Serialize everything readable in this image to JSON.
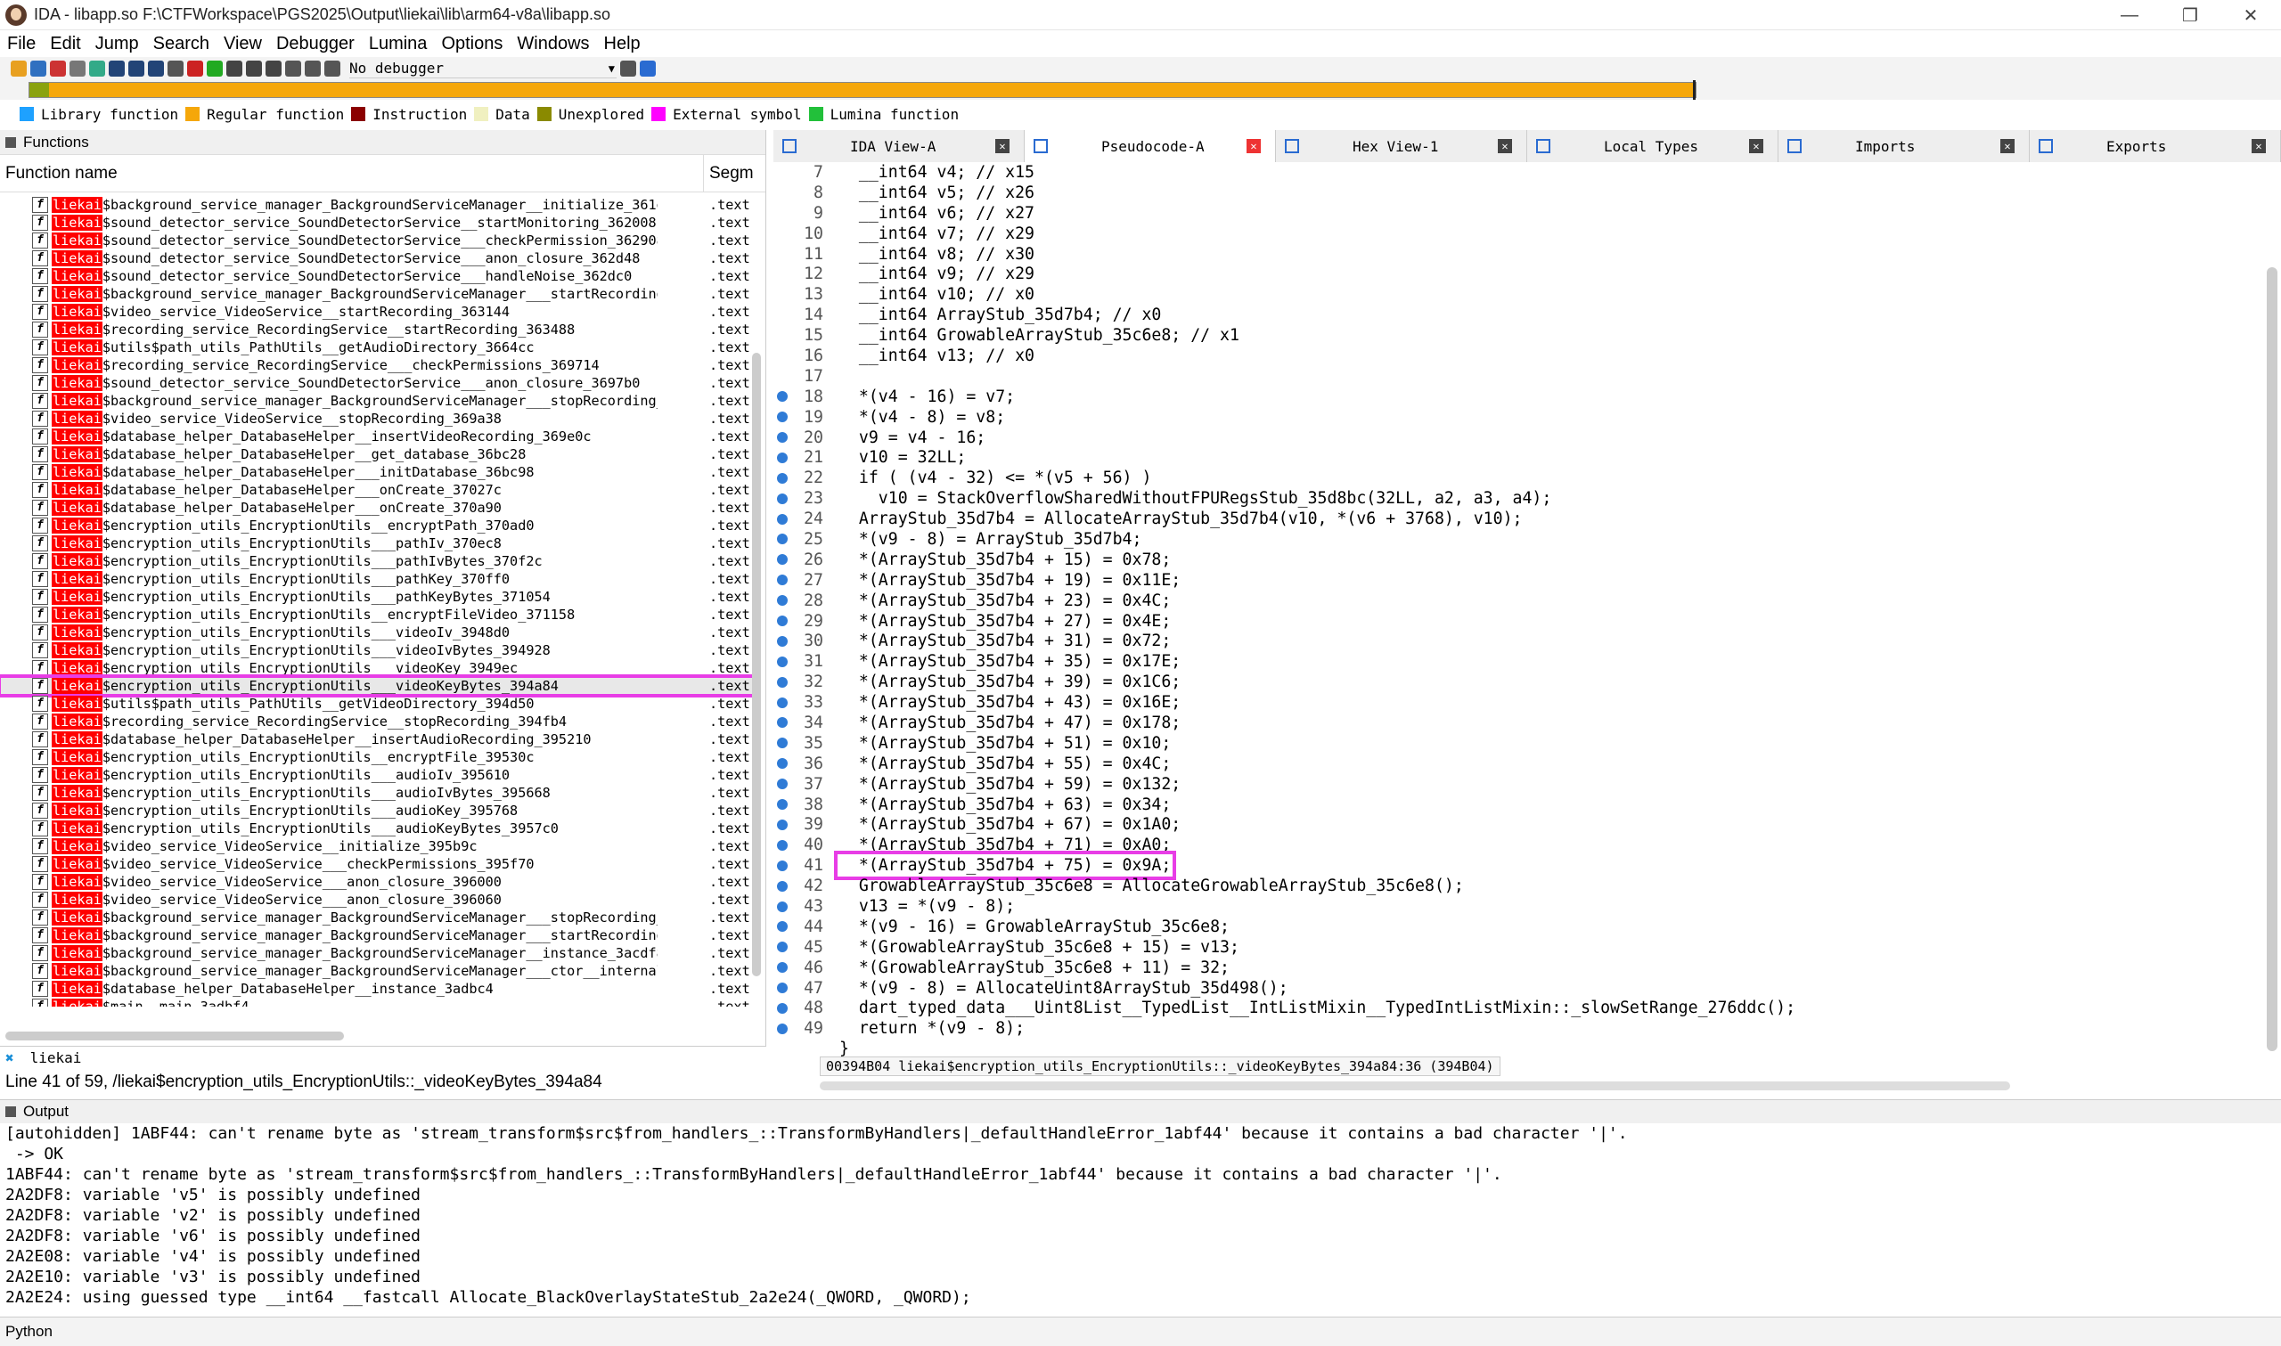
{
  "window": {
    "title": "IDA - libapp.so F:\\CTFWorkspace\\PGS2025\\Output\\liekai\\lib\\arm64-v8a\\libapp.so"
  },
  "menu": [
    "File",
    "Edit",
    "Jump",
    "Search",
    "View",
    "Debugger",
    "Lumina",
    "Options",
    "Windows",
    "Help"
  ],
  "toolbar": {
    "debugger": "No debugger"
  },
  "legend": [
    {
      "label": "Library function",
      "color": "#1ea1ff"
    },
    {
      "label": "Regular function",
      "color": "#f5a70a"
    },
    {
      "label": "Instruction",
      "color": "#8b0000"
    },
    {
      "label": "Data",
      "color": "#f0f0c0"
    },
    {
      "label": "Unexplored",
      "color": "#8a8a00"
    },
    {
      "label": "External symbol",
      "color": "#ff00ff"
    },
    {
      "label": "Lumina function",
      "color": "#22c03a"
    }
  ],
  "functions_panel": {
    "title": "Functions",
    "col_name": "Function name",
    "col_seg": "Segm",
    "prefix": "liekai",
    "rows": [
      {
        "n": "$background_service_manager_BackgroundServiceManager__initialize_361e30",
        "s": ".text"
      },
      {
        "n": "$sound_detector_service_SoundDetectorService__startMonitoring_362008",
        "s": ".text"
      },
      {
        "n": "$sound_detector_service_SoundDetectorService___checkPermission_362908",
        "s": ".text"
      },
      {
        "n": "$sound_detector_service_SoundDetectorService___anon_closure_362d48",
        "s": ".text"
      },
      {
        "n": "$sound_detector_service_SoundDetectorService___handleNoise_362dc0",
        "s": ".text"
      },
      {
        "n": "$background_service_manager_BackgroundServiceManager___startRecording_36…",
        "s": ".text"
      },
      {
        "n": "$video_service_VideoService__startRecording_363144",
        "s": ".text"
      },
      {
        "n": "$recording_service_RecordingService__startRecording_363488",
        "s": ".text"
      },
      {
        "n": "$utils$path_utils_PathUtils__getAudioDirectory_3664cc",
        "s": ".text"
      },
      {
        "n": "$recording_service_RecordingService___checkPermissions_369714",
        "s": ".text"
      },
      {
        "n": "$sound_detector_service_SoundDetectorService___anon_closure_3697b0",
        "s": ".text"
      },
      {
        "n": "$background_service_manager_BackgroundServiceManager___stopRecording_369…",
        "s": ".text"
      },
      {
        "n": "$video_service_VideoService__stopRecording_369a38",
        "s": ".text"
      },
      {
        "n": "$database_helper_DatabaseHelper__insertVideoRecording_369e0c",
        "s": ".text"
      },
      {
        "n": "$database_helper_DatabaseHelper__get_database_36bc28",
        "s": ".text"
      },
      {
        "n": "$database_helper_DatabaseHelper___initDatabase_36bc98",
        "s": ".text"
      },
      {
        "n": "$database_helper_DatabaseHelper___onCreate_37027c",
        "s": ".text"
      },
      {
        "n": "$database_helper_DatabaseHelper___onCreate_370a90",
        "s": ".text"
      },
      {
        "n": "$encryption_utils_EncryptionUtils__encryptPath_370ad0",
        "s": ".text"
      },
      {
        "n": "$encryption_utils_EncryptionUtils___pathIv_370ec8",
        "s": ".text"
      },
      {
        "n": "$encryption_utils_EncryptionUtils___pathIvBytes_370f2c",
        "s": ".text"
      },
      {
        "n": "$encryption_utils_EncryptionUtils___pathKey_370ff0",
        "s": ".text"
      },
      {
        "n": "$encryption_utils_EncryptionUtils___pathKeyBytes_371054",
        "s": ".text"
      },
      {
        "n": "$encryption_utils_EncryptionUtils__encryptFileVideo_371158",
        "s": ".text"
      },
      {
        "n": "$encryption_utils_EncryptionUtils___videoIv_3948d0",
        "s": ".text"
      },
      {
        "n": "$encryption_utils_EncryptionUtils___videoIvBytes_394928",
        "s": ".text"
      },
      {
        "n": "$encryption_utils_EncryptionUtils___videoKey_3949ec",
        "s": ".text"
      },
      {
        "n": "$encryption_utils_EncryptionUtils___videoKeyBytes_394a84",
        "s": ".text",
        "hl": true
      },
      {
        "n": "$utils$path_utils_PathUtils__getVideoDirectory_394d50",
        "s": ".text"
      },
      {
        "n": "$recording_service_RecordingService__stopRecording_394fb4",
        "s": ".text"
      },
      {
        "n": "$database_helper_DatabaseHelper__insertAudioRecording_395210",
        "s": ".text"
      },
      {
        "n": "$encryption_utils_EncryptionUtils__encryptFile_39530c",
        "s": ".text"
      },
      {
        "n": "$encryption_utils_EncryptionUtils___audioIv_395610",
        "s": ".text"
      },
      {
        "n": "$encryption_utils_EncryptionUtils___audioIvBytes_395668",
        "s": ".text"
      },
      {
        "n": "$encryption_utils_EncryptionUtils___audioKey_395768",
        "s": ".text"
      },
      {
        "n": "$encryption_utils_EncryptionUtils___audioKeyBytes_3957c0",
        "s": ".text"
      },
      {
        "n": "$video_service_VideoService__initialize_395b9c",
        "s": ".text"
      },
      {
        "n": "$video_service_VideoService___checkPermissions_395f70",
        "s": ".text"
      },
      {
        "n": "$video_service_VideoService___anon_closure_396000",
        "s": ".text"
      },
      {
        "n": "$video_service_VideoService___anon_closure_396060",
        "s": ".text"
      },
      {
        "n": "$background_service_manager_BackgroundServiceManager___stopRecording_396…",
        "s": ".text"
      },
      {
        "n": "$background_service_manager_BackgroundServiceManager___startRecording_39…",
        "s": ".text"
      },
      {
        "n": "$background_service_manager_BackgroundServiceManager__instance_3acdf8",
        "s": ".text"
      },
      {
        "n": "$background_service_manager_BackgroundServiceManager___ctor__internal_3ac…",
        "s": ".text"
      },
      {
        "n": "$database_helper_DatabaseHelper__instance_3adbc4",
        "s": ".text"
      },
      {
        "n": "$main__main_3adbf4",
        "s": ".text"
      }
    ],
    "filter": "liekai",
    "line_info": "Line 41 of 59, /liekai$encryption_utils_EncryptionUtils::_videoKeyBytes_394a84"
  },
  "tabs": [
    {
      "label": "IDA View-A"
    },
    {
      "label": "Pseudocode-A",
      "active": true
    },
    {
      "label": "Hex View-1"
    },
    {
      "label": "Local Types"
    },
    {
      "label": "Imports"
    },
    {
      "label": "Exports"
    }
  ],
  "code_lines": [
    {
      "n": "7",
      "t": "  __int64 v4; // x15"
    },
    {
      "n": "8",
      "t": "  __int64 v5; // x26"
    },
    {
      "n": "9",
      "t": "  __int64 v6; // x27"
    },
    {
      "n": "10",
      "t": "  __int64 v7; // x29"
    },
    {
      "n": "11",
      "t": "  __int64 v8; // x30"
    },
    {
      "n": "12",
      "t": "  __int64 v9; // x29"
    },
    {
      "n": "13",
      "t": "  __int64 v10; // x0"
    },
    {
      "n": "14",
      "t": "  __int64 ArrayStub_35d7b4; // x0"
    },
    {
      "n": "15",
      "t": "  __int64 GrowableArrayStub_35c6e8; // x1"
    },
    {
      "n": "16",
      "t": "  __int64 v13; // x0"
    },
    {
      "n": "17",
      "t": ""
    },
    {
      "n": "18",
      "t": "  *(v4 - 16) = v7;",
      "d": true
    },
    {
      "n": "19",
      "t": "  *(v4 - 8) = v8;",
      "d": true
    },
    {
      "n": "20",
      "t": "  v9 = v4 - 16;",
      "d": true
    },
    {
      "n": "21",
      "t": "  v10 = 32LL;",
      "d": true
    },
    {
      "n": "22",
      "t": "  if ( (v4 - 32) <= *(v5 + 56) )",
      "d": true
    },
    {
      "n": "23",
      "t": "    v10 = StackOverflowSharedWithoutFPURegsStub_35d8bc(32LL, a2, a3, a4);",
      "d": true
    },
    {
      "n": "24",
      "t": "  ArrayStub_35d7b4 = AllocateArrayStub_35d7b4(v10, *(v6 + 3768), v10);",
      "d": true
    },
    {
      "n": "25",
      "t": "  *(v9 - 8) = ArrayStub_35d7b4;",
      "d": true
    },
    {
      "n": "26",
      "t": "  *(ArrayStub_35d7b4 + 15) = 0x78;",
      "d": true
    },
    {
      "n": "27",
      "t": "  *(ArrayStub_35d7b4 + 19) = 0x11E;",
      "d": true
    },
    {
      "n": "28",
      "t": "  *(ArrayStub_35d7b4 + 23) = 0x4C;",
      "d": true
    },
    {
      "n": "29",
      "t": "  *(ArrayStub_35d7b4 + 27) = 0x4E;",
      "d": true
    },
    {
      "n": "30",
      "t": "  *(ArrayStub_35d7b4 + 31) = 0x72;",
      "d": true
    },
    {
      "n": "31",
      "t": "  *(ArrayStub_35d7b4 + 35) = 0x17E;",
      "d": true
    },
    {
      "n": "32",
      "t": "  *(ArrayStub_35d7b4 + 39) = 0x1C6;",
      "d": true
    },
    {
      "n": "33",
      "t": "  *(ArrayStub_35d7b4 + 43) = 0x16E;",
      "d": true
    },
    {
      "n": "34",
      "t": "  *(ArrayStub_35d7b4 + 47) = 0x178;",
      "d": true
    },
    {
      "n": "35",
      "t": "  *(ArrayStub_35d7b4 + 51) = 0x10;",
      "d": true
    },
    {
      "n": "36",
      "t": "  *(ArrayStub_35d7b4 + 55) = 0x4C;",
      "d": true
    },
    {
      "n": "37",
      "t": "  *(ArrayStub_35d7b4 + 59) = 0x132;",
      "d": true
    },
    {
      "n": "38",
      "t": "  *(ArrayStub_35d7b4 + 63) = 0x34;",
      "d": true
    },
    {
      "n": "39",
      "t": "  *(ArrayStub_35d7b4 + 67) = 0x1A0;",
      "d": true
    },
    {
      "n": "40",
      "t": "  *(ArrayStub_35d7b4 + 71) = 0xA0;",
      "d": true
    },
    {
      "n": "41",
      "t": "  *(ArrayStub_35d7b4 + 75) = 0x9A;",
      "d": true,
      "hl": true
    },
    {
      "n": "42",
      "t": "  GrowableArrayStub_35c6e8 = AllocateGrowableArrayStub_35c6e8();",
      "d": true
    },
    {
      "n": "43",
      "t": "  v13 = *(v9 - 8);",
      "d": true
    },
    {
      "n": "44",
      "t": "  *(v9 - 16) = GrowableArrayStub_35c6e8;",
      "d": true
    },
    {
      "n": "45",
      "t": "  *(GrowableArrayStub_35c6e8 + 15) = v13;",
      "d": true
    },
    {
      "n": "46",
      "t": "  *(GrowableArrayStub_35c6e8 + 11) = 32;",
      "d": true
    },
    {
      "n": "47",
      "t": "  *(v9 - 8) = AllocateUint8ArrayStub_35d498();",
      "d": true
    },
    {
      "n": "48",
      "t": "  dart_typed_data___Uint8List__TypedList__IntListMixin__TypedIntListMixin::_slowSetRange_276ddc();",
      "d": true
    },
    {
      "n": "49",
      "t": "  return *(v9 - 8);",
      "d": true
    },
    {
      "n": "",
      "t": "}"
    }
  ],
  "code_status": "00394B04 liekai$encryption_utils_EncryptionUtils::_videoKeyBytes_394a84:36 (394B04)",
  "output": {
    "title": "Output",
    "lines": [
      "[autohidden] 1ABF44: can't rename byte as 'stream_transform$src$from_handlers_::TransformByHandlers|_defaultHandleError_1abf44' because it contains a bad character '|'.",
      " -> OK",
      "1ABF44: can't rename byte as 'stream_transform$src$from_handlers_::TransformByHandlers|_defaultHandleError_1abf44' because it contains a bad character '|'.",
      "2A2DF8: variable 'v5' is possibly undefined",
      "2A2DF8: variable 'v2' is possibly undefined",
      "2A2DF8: variable 'v6' is possibly undefined",
      "2A2E08: variable 'v4' is possibly undefined",
      "2A2E10: variable 'v3' is possibly undefined",
      "2A2E24: using guessed type __int64 __fastcall Allocate_BlackOverlayStateStub_2a2e24(_QWORD, _QWORD);"
    ]
  },
  "python": "Python"
}
